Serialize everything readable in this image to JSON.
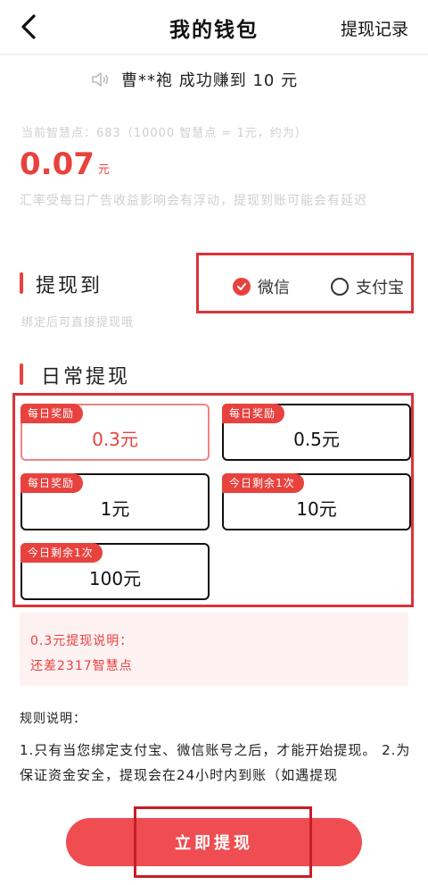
{
  "header": {
    "title": "我的钱包",
    "records_label": "提现记录"
  },
  "ticker": {
    "text": "曹**袍  成功赚到 10 元"
  },
  "wallet": {
    "points_line": "当前智慧点：683（10000 智慧点 = 1元，约为）",
    "balance": "0.07",
    "balance_unit": "元",
    "rate_note": "汇率受每日广告收益影响会有浮动，提现到账可能会有延迟"
  },
  "withdraw_to": {
    "title": "提现到",
    "bind_hint": "绑定后可直接提现哦",
    "options": [
      {
        "label": "微信",
        "selected": true
      },
      {
        "label": "支付宝",
        "selected": false
      }
    ]
  },
  "daily": {
    "title": "日常提现",
    "tiers": [
      {
        "badge": "每日奖励",
        "amount": "0.3元",
        "selected": true
      },
      {
        "badge": "每日奖励",
        "amount": "0.5元",
        "selected": false
      },
      {
        "badge": "每日奖励",
        "amount": "1元",
        "selected": false
      },
      {
        "badge": "今日剩余1次",
        "amount": "10元",
        "selected": false
      },
      {
        "badge": "今日剩余1次",
        "amount": "100元",
        "selected": false
      }
    ]
  },
  "note": {
    "line1": "0.3元提现说明：",
    "line2": "还差2317智慧点"
  },
  "rules": {
    "title": "规则说明：",
    "text": "1.只有当您绑定支付宝、微信账号之后，才能开始提现。 2.为保证资金安全，提现会在24小时内到账（如遇提现"
  },
  "action": {
    "withdraw_label": "立即提现"
  },
  "colors": {
    "accent": "#e8423f",
    "highlight_border": "#d9333a"
  }
}
